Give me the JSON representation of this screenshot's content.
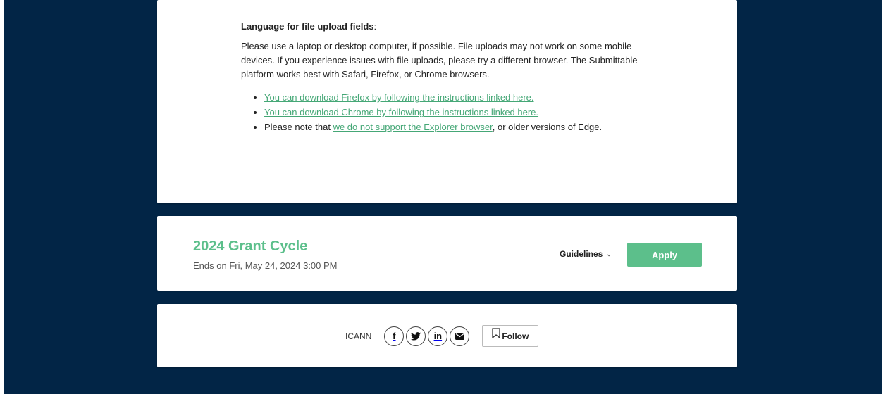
{
  "upload_info": {
    "heading": "Language for file upload fields",
    "heading_suffix": ":",
    "paragraph": "Please use a laptop or desktop computer, if possible. File uploads may not work on some mobile devices. If you experience issues with file uploads, please try a different browser. The Submittable platform works best with Safari, Firefox, or Chrome browsers.",
    "links": {
      "firefox": "You can download Firefox by following the instructions linked here.",
      "chrome": "You can download Chrome by following the instructions linked here."
    },
    "note": {
      "prefix": "Please note that ",
      "link": "we do not support the Explorer browser",
      "suffix": ", or older versions of Edge."
    }
  },
  "grant": {
    "title": "2024 Grant Cycle",
    "ends": "Ends on Fri, May 24, 2024 3:00 PM",
    "guidelines_label": "Guidelines",
    "apply_label": "Apply"
  },
  "footer": {
    "org_name": "ICANN",
    "social": [
      "facebook-icon",
      "twitter-icon",
      "linkedin-icon",
      "email-icon"
    ],
    "follow_label": "Follow"
  },
  "colors": {
    "background": "#022546",
    "accent": "#5cbf8b",
    "link": "#45a776"
  }
}
